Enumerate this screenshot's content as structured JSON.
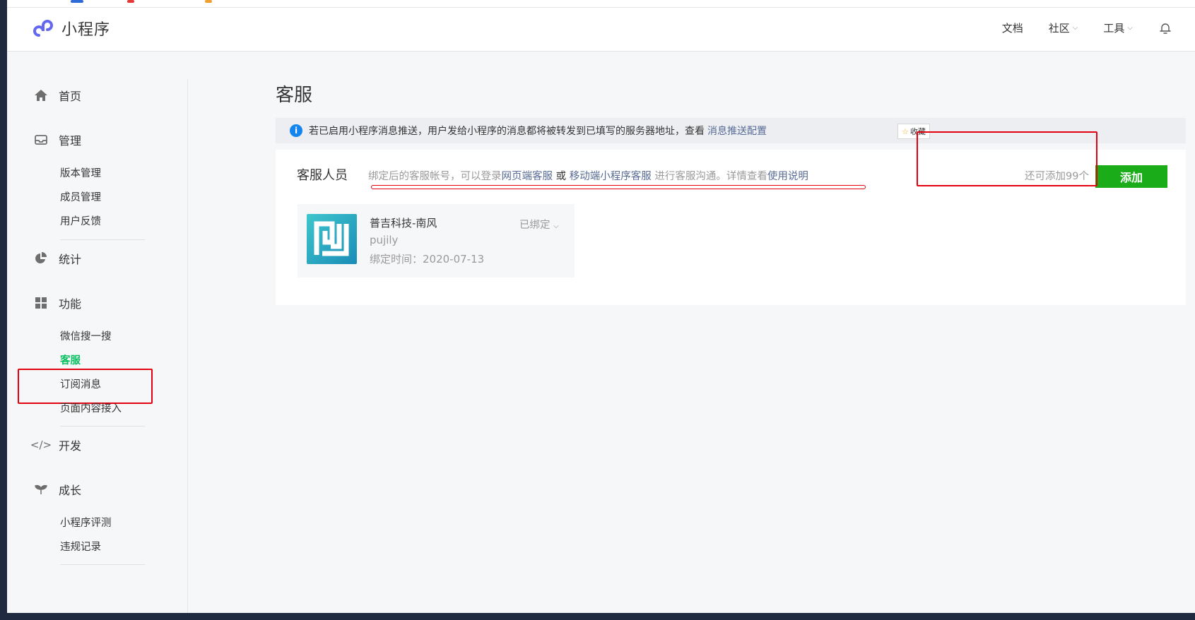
{
  "header": {
    "app_title": "小程序",
    "nav": [
      {
        "label": "文档",
        "has_dropdown": false
      },
      {
        "label": "社区",
        "has_dropdown": true
      },
      {
        "label": "工具",
        "has_dropdown": true
      }
    ],
    "bell_icon": "bell-icon"
  },
  "sidebar": {
    "groups": {
      "home": {
        "label": "首页",
        "icon": "home-icon"
      },
      "manage": {
        "label": "管理",
        "icon": "inbox-icon",
        "items": [
          "版本管理",
          "成员管理",
          "用户反馈"
        ]
      },
      "stats": {
        "label": "统计",
        "icon": "pie-chart-icon"
      },
      "features": {
        "label": "功能",
        "icon": "grid-icon",
        "items": [
          "微信搜一搜",
          "客服",
          "订阅消息",
          "页面内容接入"
        ]
      },
      "dev": {
        "label": "开发",
        "icon": "code-icon"
      },
      "growth": {
        "label": "成长",
        "icon": "sprout-icon",
        "items": [
          "小程序评测",
          "违规记录"
        ]
      }
    },
    "active_item": "客服"
  },
  "main": {
    "title": "客服",
    "notice": {
      "text": "若已启用小程序消息推送，用户发给小程序的消息都将被转发到已填写的服务器地址，查看",
      "link": "消息推送配置",
      "fav_label": "收藏"
    },
    "staff": {
      "label": "客服人员",
      "desc_prefix": "绑定后的客服帐号，可以登录",
      "link_web": "网页端客服",
      "or": " 或 ",
      "link_mobile": "移动端小程序客服",
      "desc_mid": " 进行客服沟通。详情查看",
      "link_help": "使用说明",
      "quota": "还可添加99个",
      "add_label": "添加",
      "members": [
        {
          "name": "普吉科技-南风",
          "id": "pujily",
          "bind_time": "绑定时间：2020-07-13",
          "status": "已绑定"
        }
      ]
    }
  },
  "colors": {
    "accent_green": "#1aad19",
    "active_text": "#07c160",
    "link": "#576b95",
    "highlight_red": "#e4000f"
  }
}
